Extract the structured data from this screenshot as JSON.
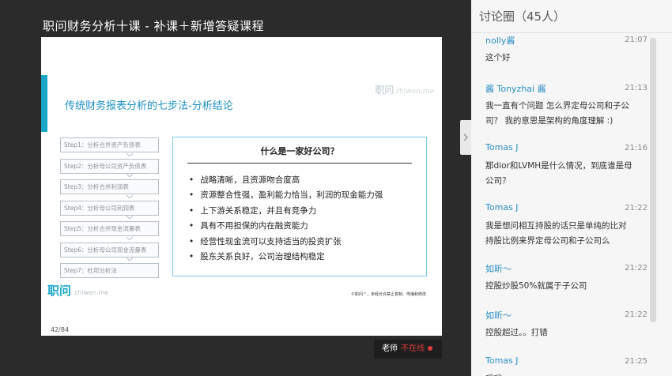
{
  "course_title": "职问财务分析十课 - 补课＋新增答疑课程",
  "slide": {
    "heading": "传统财务报表分析的七步法-分析结论",
    "brand_top": "职问",
    "brand_top_sub": "zhiwen.me",
    "steps": [
      "Step1：分析合并资产负债表",
      "Step2：分析母公司资产负债表",
      "Step3：分析合并利润表",
      "Step4：分析母公司利润表",
      "Step5：分析合并现金流量表",
      "Step6：分析母公司现金流量表",
      "Step7：杜邦分析法"
    ],
    "answer_title": "什么是一家好公司？",
    "points": [
      "战略清晰，且资源吻合度高",
      "资源整合性强，盈利能力恰当，利润的现金能力强",
      "上下游关系稳定，并且有竞争力",
      "具有不用担保的内在融资能力",
      "经营性现金流可以支持适当的投资扩张",
      "股东关系良好，公司治理结构稳定"
    ],
    "logo": "职问",
    "logo_sub": "zhiwen.me",
    "footnote": "©职问™，未经允许禁止复制、传播和修改",
    "page_number": "42/84"
  },
  "teacher_status": {
    "label": "老师",
    "status": "不在线"
  },
  "chat": {
    "title": "讨论圈（45人）",
    "messages": [
      {
        "name": "nolly酱",
        "time": "21:07",
        "lines": [
          "这个好"
        ]
      },
      {
        "name": "酱 Tonyzhai 酱",
        "time": "21:13",
        "lines": [
          "我一直有个问题 怎么界定母公司和子公",
          "司？ 我的意思是架构的角度理解 :)"
        ]
      },
      {
        "name": "Tomas J",
        "time": "21:16",
        "lines": [
          "那dior和LVMH是什么情况，到底谁是母",
          "公司？"
        ]
      },
      {
        "name": "Tomas J",
        "time": "21:22",
        "lines": [
          "我是想问相互持股的话只是单纯的比对",
          "持股比例来界定母公司和子公司么"
        ]
      },
      {
        "name": "如昕～",
        "time": "21:22",
        "lines": [
          "控股炒股50%就属于子公司"
        ]
      },
      {
        "name": "如昕～",
        "time": "21:22",
        "lines": [
          "控股超过。。打错"
        ]
      },
      {
        "name": "Tomas J",
        "time": "21:25",
        "lines": [
          "嗯嗯"
        ]
      }
    ]
  },
  "colors": {
    "accent": "#1aa7c8",
    "link": "#2a8dc5",
    "offline": "#e03c3c"
  }
}
